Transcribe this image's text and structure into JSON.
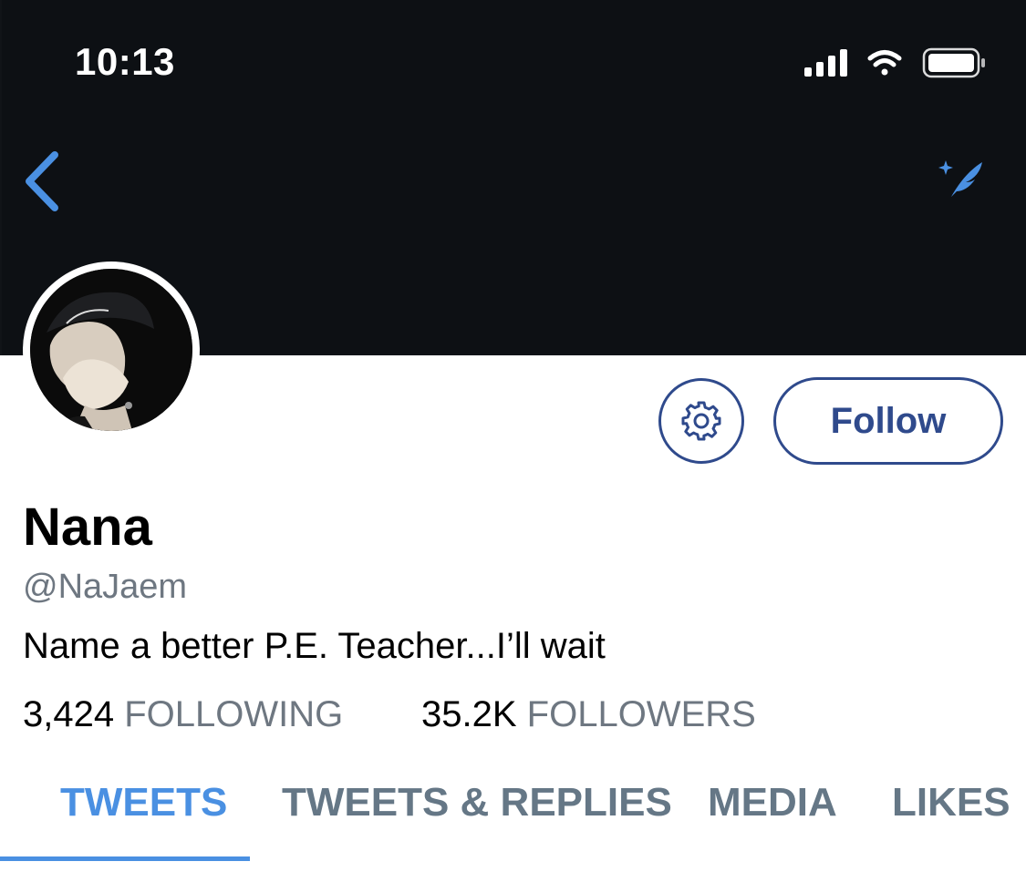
{
  "status_bar": {
    "time": "10:13"
  },
  "profile": {
    "display_name": "Nana",
    "handle": "@NaJaem",
    "bio": "Name a better P.E. Teacher...I’ll wait",
    "follow_label": "Follow"
  },
  "stats": {
    "following_count": "3,424",
    "following_label": "FOLLOWING",
    "followers_count": "35.2K",
    "followers_label": "FOLLOWERS"
  },
  "tabs": [
    {
      "label": "TWEETS",
      "active": true
    },
    {
      "label": "TWEETS & REPLIES",
      "active": false
    },
    {
      "label": "MEDIA",
      "active": false
    },
    {
      "label": "LIKES",
      "active": false
    }
  ],
  "colors": {
    "accent": "#4a90e2",
    "button_border": "#2f4a8c",
    "header_bg": "#0d1014",
    "muted_text": "#6e7781"
  },
  "icons": {
    "back": "chevron-left-icon",
    "compose": "sparkle-feather-icon",
    "settings": "gear-icon",
    "signal": "cellular-signal-icon",
    "wifi": "wifi-icon",
    "battery": "battery-icon"
  }
}
